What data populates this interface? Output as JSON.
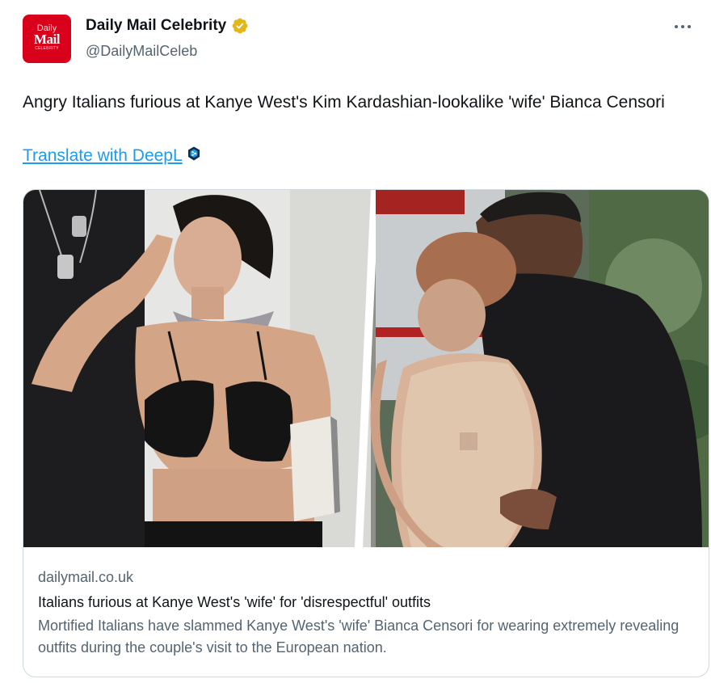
{
  "author": {
    "display_name": "Daily Mail Celebrity",
    "handle": "@DailyMailCeleb",
    "avatar": {
      "line1": "Daily",
      "line2": "Mail",
      "line3": "CELEBRITY",
      "bg_color": "#d9001b"
    },
    "verified_badge_icon": "verified-badge-icon",
    "verified_color": "#e2b719"
  },
  "menu": {
    "more_icon": "more-options-icon"
  },
  "tweet": {
    "text": "Angry Italians furious at Kanye West's Kim Kardashian-lookalike 'wife' Bianca Censori",
    "translate_label": "Translate with DeepL",
    "translate_icon": "deepl-icon"
  },
  "card": {
    "domain": "dailymail.co.uk",
    "title": "Italians furious at Kanye West's 'wife' for 'disrespectful' outfits",
    "description": "Mortified Italians have slammed Kanye West's 'wife' Bianca Censori for wearing extremely revealing outfits during the couple's visit to the European nation."
  },
  "colors": {
    "text_primary": "#0f1419",
    "text_secondary": "#536471",
    "link": "#1d9bf0",
    "border": "#cfd9de"
  }
}
